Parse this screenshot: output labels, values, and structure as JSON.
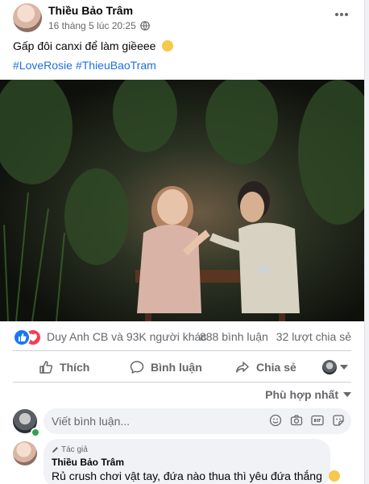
{
  "post": {
    "author": "Thiều Bảo Trâm",
    "time": "16 tháng 5 lúc 20:25",
    "privacy_icon": "globe-icon",
    "caption": "Gấp đôi canxi để làm giềeee",
    "caption_emoji": "rolling-eyes-emoji",
    "hashtags": [
      "#LoveRosie",
      "#ThieuBaoTram"
    ]
  },
  "reactions": {
    "icons": [
      "like-icon",
      "love-icon"
    ],
    "names": "Duy Anh CB và 93K người khác",
    "comments": "888 bình luận",
    "shares": "32 lượt chia sẻ"
  },
  "actions": {
    "like": "Thích",
    "comment": "Bình luận",
    "share": "Chia sẻ"
  },
  "sort": {
    "label": "Phù hợp nhất"
  },
  "comment_box": {
    "placeholder": "Viết bình luận..."
  },
  "comments": [
    {
      "tag": "Tác giả",
      "author": "Thiều Bảo Trâm",
      "text": "Rủ crush chơi vật tay, đứa nào thua thì yêu đứa thắng"
    }
  ],
  "colors": {
    "link": "#216fdb",
    "like_blue": "#1877f2",
    "love_red": "#f33e58",
    "secondary_text": "#65676b"
  }
}
